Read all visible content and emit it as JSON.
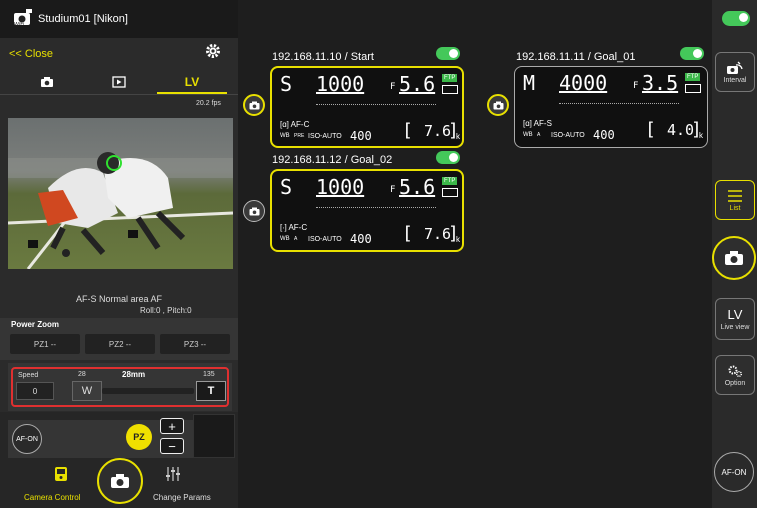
{
  "app": {
    "title": "Studium01 [Nikon]"
  },
  "left": {
    "close_label": "<< Close",
    "tabs": [
      {
        "id": "photo",
        "label": ""
      },
      {
        "id": "play",
        "label": ""
      },
      {
        "id": "lv",
        "label": "LV"
      }
    ],
    "fps": "20.2 fps",
    "af_info": "AF-S  Normal area AF",
    "roll_pitch": "Roll:0 , Pitch:0",
    "power_zoom": {
      "title": "Power Zoom",
      "presets": [
        "PZ1 --",
        "PZ2 --",
        "PZ3 --"
      ]
    },
    "zoom": {
      "speed_label": "Speed",
      "speed_value": "0",
      "min_focal": "28",
      "current_focal": "28mm",
      "max_focal": "135",
      "wide_label": "W",
      "tele_label": "T",
      "position_fraction": 0
    },
    "af_on_label": "AF-ON",
    "pz_label": "PZ",
    "plus": "+",
    "minus": "−",
    "bottom_tabs": [
      "Camera Control",
      "Change Params"
    ]
  },
  "cameras": [
    {
      "title": "192.168.11.10 / Start",
      "mode": "S",
      "shutter": "1000",
      "f_prefix": "F",
      "aperture": "5.6",
      "ftp": "FTP",
      "af_area": "[ɑ] AF-C",
      "wb": "WB",
      "wb_mode": "PRE",
      "iso_label": "ISO-AUTO",
      "iso": "400",
      "frames": "7.6",
      "k": "k",
      "selected": true
    },
    {
      "title": "192.168.11.11 / Goal_01",
      "mode": "M",
      "shutter": "4000",
      "f_prefix": "F",
      "aperture": "3.5",
      "ftp": "FTP",
      "af_area": "[ɑ] AF-S",
      "wb": "WB",
      "wb_mode": "A",
      "iso_label": "ISO-AUTO",
      "iso": "400",
      "frames": "4.0",
      "k": "k",
      "selected": false
    },
    {
      "title": "192.168.11.12 / Goal_02",
      "mode": "S",
      "shutter": "1000",
      "f_prefix": "F",
      "aperture": "5.6",
      "ftp": "FTP",
      "af_area": "[∙] AF-C",
      "wb": "WB",
      "wb_mode": "A",
      "iso_label": "ISO-AUTO",
      "iso": "400",
      "frames": "7.6",
      "k": "k",
      "selected": true
    }
  ],
  "sidebar": {
    "interval": "Interval",
    "list": "List",
    "lv_big": "LV",
    "live_view": "Live view",
    "option": "Option",
    "af_on": "AF-ON"
  },
  "colors": {
    "accent": "#e8e000",
    "toggle": "#44c85a",
    "highlight": "#e03030",
    "ftp": "#3cb84a"
  }
}
